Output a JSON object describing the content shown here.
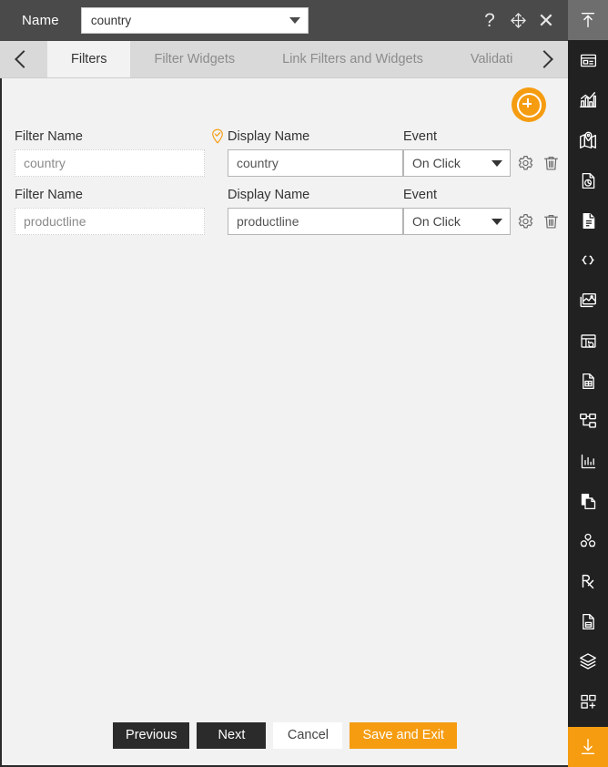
{
  "titlebar": {
    "label": "Name",
    "name_value": "country",
    "help_icon": "question-mark-icon",
    "move_icon": "move-icon",
    "close_icon": "close-icon"
  },
  "tabbar": {
    "prev_icon": "chevron-left-icon",
    "next_icon": "chevron-right-icon",
    "tabs": [
      {
        "label": "Filters",
        "active": true
      },
      {
        "label": "Filter Widgets",
        "active": false
      },
      {
        "label": "Link Filters and Widgets",
        "active": false
      },
      {
        "label": "Validati",
        "active": false
      }
    ]
  },
  "content": {
    "add_button_label": "add-filter",
    "columns": {
      "filter_name": "Filter Name",
      "display_name": "Display Name",
      "event": "Event"
    },
    "rows": [
      {
        "filter_name": "country",
        "display_name": "country",
        "event": "On Click",
        "has_validation_pin": true,
        "settings_icon": "gear-icon",
        "delete_icon": "trash-icon"
      },
      {
        "filter_name": "productline",
        "display_name": "productline",
        "event": "On Click",
        "has_validation_pin": false,
        "settings_icon": "gear-icon",
        "delete_icon": "trash-icon"
      }
    ],
    "event_options": [
      "On Click"
    ]
  },
  "footer": {
    "previous": "Previous",
    "next": "Next",
    "cancel": "Cancel",
    "save_and_exit": "Save and Exit"
  },
  "rail": {
    "items": [
      {
        "icon": "upload-icon",
        "state": "active-top"
      },
      {
        "icon": "dashboard-panel-icon",
        "state": "normal"
      },
      {
        "icon": "chart-analytics-icon",
        "state": "normal"
      },
      {
        "icon": "map-pin-icon",
        "state": "normal"
      },
      {
        "icon": "report-pie-icon",
        "state": "normal"
      },
      {
        "icon": "document-icon",
        "state": "normal"
      },
      {
        "icon": "code-braces-icon",
        "state": "normal"
      },
      {
        "icon": "image-gallery-icon",
        "state": "normal"
      },
      {
        "icon": "table-refresh-icon",
        "state": "normal"
      },
      {
        "icon": "document-grid-icon",
        "state": "normal"
      },
      {
        "icon": "hierarchy-tree-icon",
        "state": "normal"
      },
      {
        "icon": "bar-chart-icon",
        "state": "normal"
      },
      {
        "icon": "copy-page-icon",
        "state": "normal"
      },
      {
        "icon": "cubes-icon",
        "state": "normal"
      },
      {
        "icon": "prescription-rx-icon",
        "state": "normal"
      },
      {
        "icon": "document-save-icon",
        "state": "normal"
      },
      {
        "icon": "layers-icon",
        "state": "normal"
      },
      {
        "icon": "add-widget-icon",
        "state": "normal"
      },
      {
        "icon": "download-icon",
        "state": "active-bottom"
      }
    ]
  },
  "colors": {
    "accent": "#f59c11",
    "titlebar": "#4a4a4a",
    "rail": "#212121",
    "content_bg": "#f2f2f2",
    "tab_bg": "#d9d9d9"
  }
}
